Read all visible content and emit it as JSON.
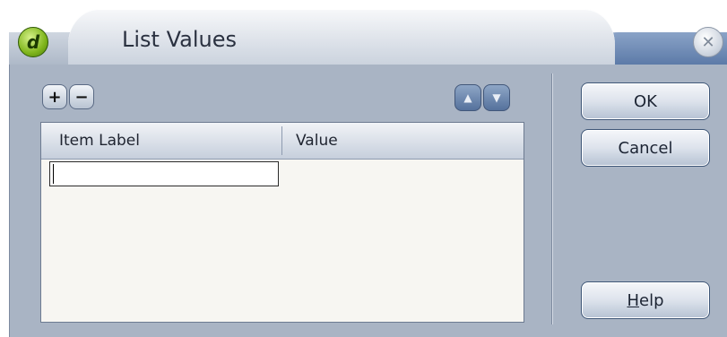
{
  "window": {
    "title": "List Values",
    "app_icon_glyph": "d",
    "close_glyph": "✕"
  },
  "toolbar": {
    "add_glyph": "+",
    "remove_glyph": "−",
    "move_up_glyph": "▲",
    "move_down_glyph": "▼"
  },
  "grid": {
    "columns": [
      "Item Label",
      "Value"
    ],
    "rows": [
      {
        "label": "",
        "value": ""
      }
    ]
  },
  "buttons": {
    "ok": "OK",
    "cancel": "Cancel",
    "help": "Help"
  }
}
